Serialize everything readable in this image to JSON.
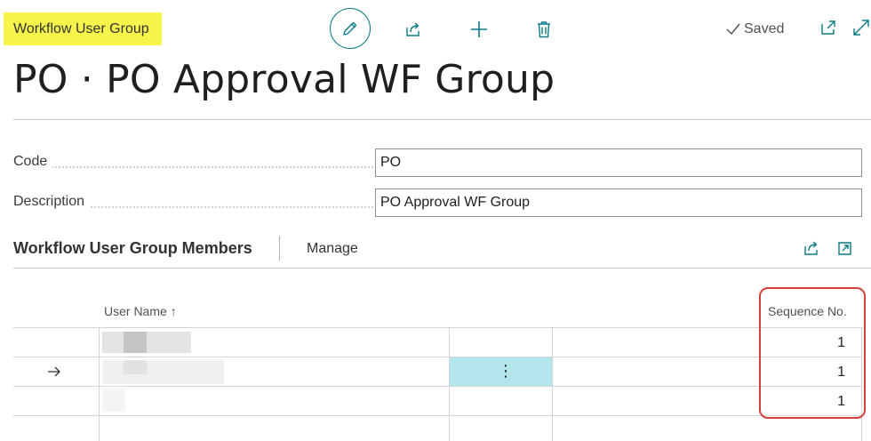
{
  "header": {
    "caption": "Workflow User Group",
    "status": "Saved",
    "actions": {
      "edit": "edit-icon",
      "share": "share-icon",
      "new": "plus-icon",
      "delete": "trash-icon",
      "popout": "popout-icon",
      "expand": "expand-icon"
    }
  },
  "page": {
    "title": "PO · PO Approval WF Group"
  },
  "fields": {
    "code": {
      "label": "Code",
      "value": "PO"
    },
    "description": {
      "label": "Description",
      "value": "PO Approval WF Group"
    }
  },
  "members": {
    "title": "Workflow User Group Members",
    "manage_label": "Manage",
    "columns": {
      "user_name": "User Name",
      "sort_indicator": "↑",
      "sequence_no": "Sequence No."
    },
    "rows": [
      {
        "user_name": "",
        "sequence_no": "1",
        "selected": false
      },
      {
        "user_name": "",
        "sequence_no": "1",
        "selected": true
      },
      {
        "user_name": "",
        "sequence_no": "1",
        "selected": false
      }
    ],
    "row_menu_glyph": "⋮"
  },
  "colors": {
    "accent": "#0b7a87",
    "caption_highlight": "#f7f54b",
    "annotation_red": "#d9403a",
    "selected_cell": "#b2e6ec"
  }
}
